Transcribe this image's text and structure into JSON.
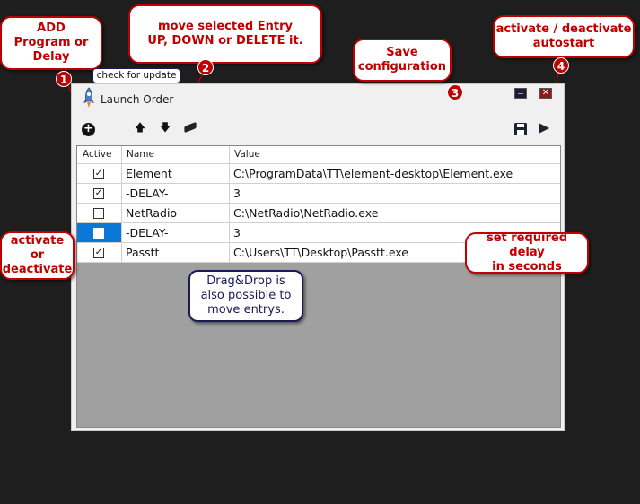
{
  "window": {
    "title": "Launch Order",
    "close_glyph": "✕"
  },
  "toolbar": {
    "add_icon": "plus-circle-icon",
    "add_glyph": "+",
    "up_glyph": "🡅",
    "down_glyph": "🡇",
    "save_glyph": "💾"
  },
  "table": {
    "headers": [
      "Active",
      "Name",
      "Value"
    ],
    "rows": [
      {
        "active": true,
        "name": "Element",
        "value": "C:\\ProgramData\\TT\\element-desktop\\Element.exe"
      },
      {
        "active": true,
        "name": "-DELAY-",
        "value": "3"
      },
      {
        "active": false,
        "name": "NetRadio",
        "value": "C:\\NetRadio\\NetRadio.exe"
      },
      {
        "active": false,
        "name": "-DELAY-",
        "value": "3",
        "selected": true
      },
      {
        "active": true,
        "name": "Passtt",
        "value": "C:\\Users\\TT\\Desktop\\Passtt.exe"
      }
    ],
    "check_glyph": "✓"
  },
  "annotations": {
    "add": "ADD\nProgram or\nDelay",
    "move": "move selected Entry\nUP, DOWN or DELETE it.",
    "save": "Save\nconfiguration",
    "autostart": "activate / deactivate\nautostart",
    "activate": "activate or\ndeactivate",
    "delay": "set required delay\nin seconds",
    "dragdrop": "Drag&Drop is\nalso possible to\nmove entrys.",
    "tooltip": "check for update",
    "badges": [
      "1",
      "2",
      "3",
      "4"
    ]
  },
  "colors": {
    "callout_red": "#c00000",
    "selection_blue": "#0a78d7",
    "callout_navy": "#1a1a5a"
  }
}
